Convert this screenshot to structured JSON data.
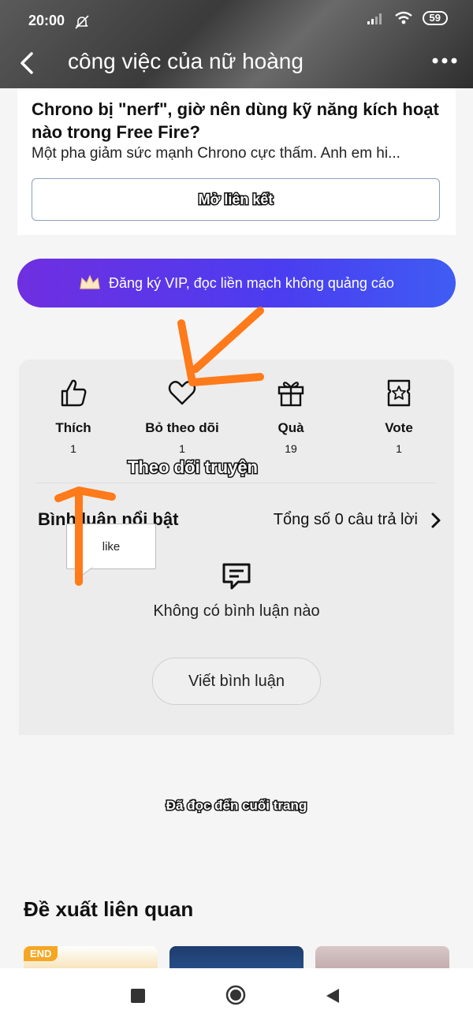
{
  "status_bar": {
    "time": "20:00",
    "battery": "59"
  },
  "header": {
    "title": "công việc của nữ hoàng"
  },
  "article_card": {
    "title": "Chrono bị \"nerf\", giờ nên dùng kỹ năng kích hoạt nào trong Free Fire?",
    "description": "Một pha giảm sức mạnh Chrono cực thấm. Anh em hi...",
    "link_button": "Mở liên kết"
  },
  "vip_banner": {
    "text": "Đăng ký VIP, đọc liền mạch không quảng cáo",
    "icon": "crown-icon"
  },
  "actions": [
    {
      "label": "Thích",
      "count": "1",
      "icon": "thumbs-up-icon"
    },
    {
      "label": "Bỏ theo dõi",
      "count": "1",
      "icon": "heart-icon"
    },
    {
      "label": "Quà",
      "count": "19",
      "icon": "gift-icon"
    },
    {
      "label": "Vote",
      "count": "1",
      "icon": "ticket-star-icon"
    }
  ],
  "annotations": {
    "follow_caption": "Theo dõi truyện",
    "tooltip": "like",
    "arrow_color": "#ff7a1a"
  },
  "comments": {
    "featured_label": "Bình luận nổi bật",
    "total_label": "Tổng số 0 câu trả lời",
    "empty_text": "Không có bình luận nào",
    "write_button": "Viết bình luận"
  },
  "end_text": "Đã đọc đến cuối trang",
  "related": {
    "title": "Đề xuất liên quan",
    "badge": "END"
  },
  "colors": {
    "vip_start": "#6f2fe0",
    "vip_end": "#3f5cf3",
    "badge": "#f5a623"
  }
}
